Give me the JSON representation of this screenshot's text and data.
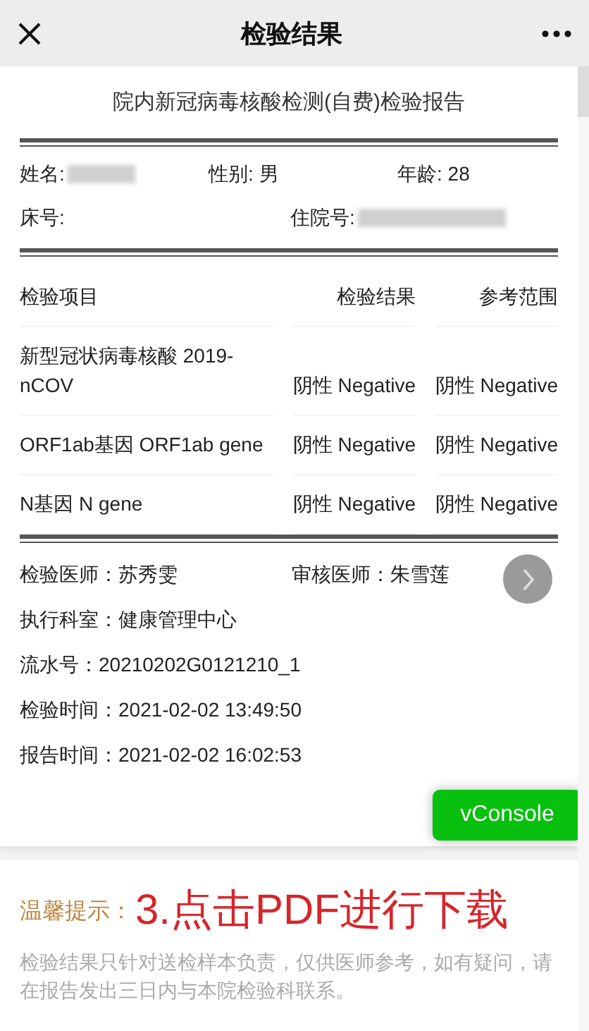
{
  "header": {
    "title": "检验结果"
  },
  "report": {
    "title": "院内新冠病毒核酸检测(自费)检验报告",
    "patient_rows": [
      [
        {
          "text": "姓名:",
          "redacted": true
        },
        {
          "text": "性别: 男",
          "redacted": false
        },
        {
          "text": "年龄: 28",
          "redacted": false
        }
      ],
      [
        {
          "text": "床号:",
          "redacted": false
        },
        {
          "text": "住院号:",
          "redacted": true
        }
      ]
    ],
    "columns": [
      "检验项目",
      "检验结果",
      "参考范围"
    ],
    "rows": [
      {
        "item": "新型冠状病毒核酸 2019-nCOV",
        "result": "阴性 Negative",
        "reference": "阴性 Negative"
      },
      {
        "item": "ORF1ab基因 ORF1ab gene",
        "result": "阴性 Negative",
        "reference": "阴性 Negative"
      },
      {
        "item": "N基因 N gene",
        "result": "阴性 Negative",
        "reference": "阴性 Negative"
      }
    ],
    "staff": [
      "检验医师：苏秀雯",
      "审核医师：朱雪莲"
    ],
    "details": [
      "执行科室：健康管理中心",
      "流水号：20210202G0121210_1",
      "检验时间：2021-02-02 13:49:50",
      "报告时间：2021-02-02 16:02:53"
    ]
  },
  "floating": {
    "console_button": "vConsole"
  },
  "tips": {
    "label": "温馨提示：",
    "annotation": "3.点击PDF进行下载",
    "note": "检验结果只针对送检样本负责，仅供医师参考，如有疑问，请在报告发出三日内与本院检验科联系。"
  }
}
